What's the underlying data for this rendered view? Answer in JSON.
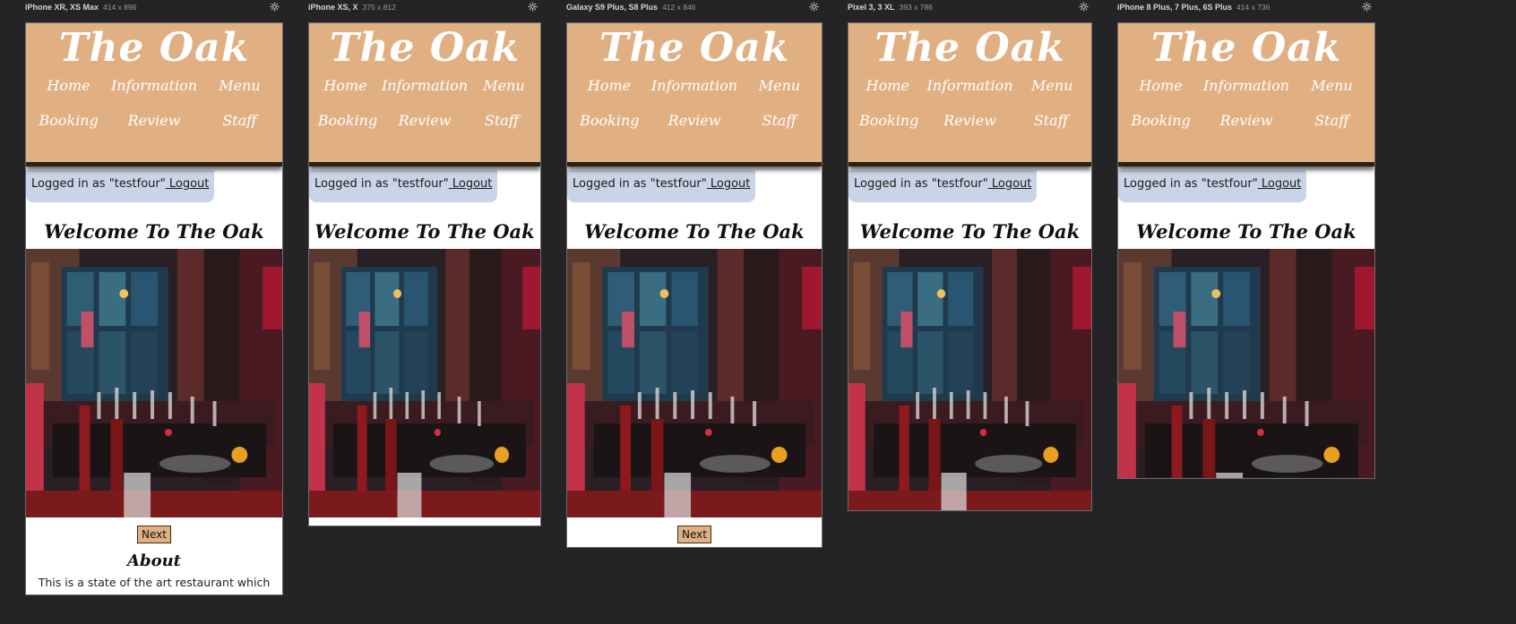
{
  "devices": [
    {
      "name": "iPhone XR, XS Max",
      "dims": "414 x 896"
    },
    {
      "name": "iPhone XS, X",
      "dims": "375 x 812"
    },
    {
      "name": "Galaxy S9 Plus, S8 Plus",
      "dims": "412 x 846"
    },
    {
      "name": "Pixel 3, 3 XL",
      "dims": "393 x 786"
    },
    {
      "name": "iPhone 8 Plus, 7 Plus, 6S Plus",
      "dims": "414 x 736"
    }
  ],
  "site": {
    "title": "The Oak",
    "nav": [
      "Home",
      "Information",
      "Menu",
      "Booking",
      "Review",
      "Staff"
    ],
    "login_text": "Logged in as \"testfour\"",
    "logout_label": " Logout",
    "welcome": "Welcome To The Oak",
    "next_label": "Next",
    "about_heading": "About",
    "about_text": "This is a state of the art restaurant which serves a wide variety of dishes that come from a plethora of"
  }
}
